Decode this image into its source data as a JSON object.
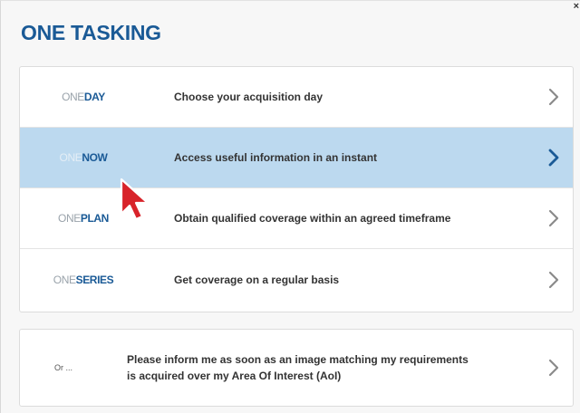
{
  "modal": {
    "title": "ONE TASKING",
    "close_label": "×"
  },
  "options": [
    {
      "brand_prefix": "ONE",
      "brand_word": "DAY",
      "description": "Choose your acquisition day",
      "highlighted": false
    },
    {
      "brand_prefix": "ONE",
      "brand_word": "NOW",
      "description": "Access useful information in an instant",
      "highlighted": true
    },
    {
      "brand_prefix": "ONE",
      "brand_word": "PLAN",
      "description": "Obtain qualified coverage within an agreed timeframe",
      "highlighted": false
    },
    {
      "brand_prefix": "ONE",
      "brand_word": "SERIES",
      "description": "Get coverage on a regular basis",
      "highlighted": false
    }
  ],
  "aoi": {
    "or_label": "Or ...",
    "description": "Please inform me as soon as an image matching my requirements is acquired over my Area Of Interest (AoI)"
  },
  "icons": {
    "chevron": "chevron-right-icon",
    "cursor": "mouse-pointer-icon"
  },
  "colors": {
    "brand_blue": "#1a5a96",
    "highlight": "#bcd9ef",
    "chevron_default": "#8a8a8a",
    "chevron_active": "#1a5a96",
    "cursor_red": "#d8232a"
  }
}
